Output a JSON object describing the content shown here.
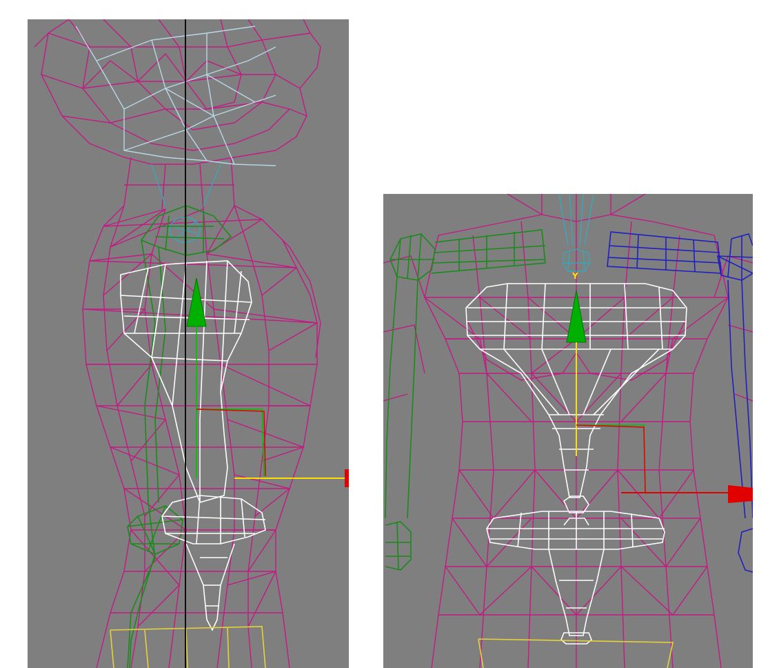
{
  "viewports": [
    {
      "name": "side",
      "label": ""
    },
    {
      "name": "front",
      "label": ""
    }
  ],
  "axis_labels": {
    "front_y": "Y"
  },
  "colors": {
    "background": "#ffffff",
    "viewport_bg": "#7f7f7f",
    "mesh": "#c21a84",
    "bone_spine": "#ffffff",
    "bone_left_arm": "#1a8a1a",
    "bone_right_arm": "#1f1fc0",
    "bone_head": "#b8d8e8",
    "bone_neck": "#3aa6b8",
    "bone_pelvis": "#e8d23a",
    "axis_x": "#e00000",
    "axis_y": "#ffe000",
    "axis_z": "#00c000",
    "pivot_line": "#000000"
  },
  "icons": [
    "move-gizmo-icon",
    "y-axis-arrow-icon",
    "x-axis-arrow-icon"
  ]
}
